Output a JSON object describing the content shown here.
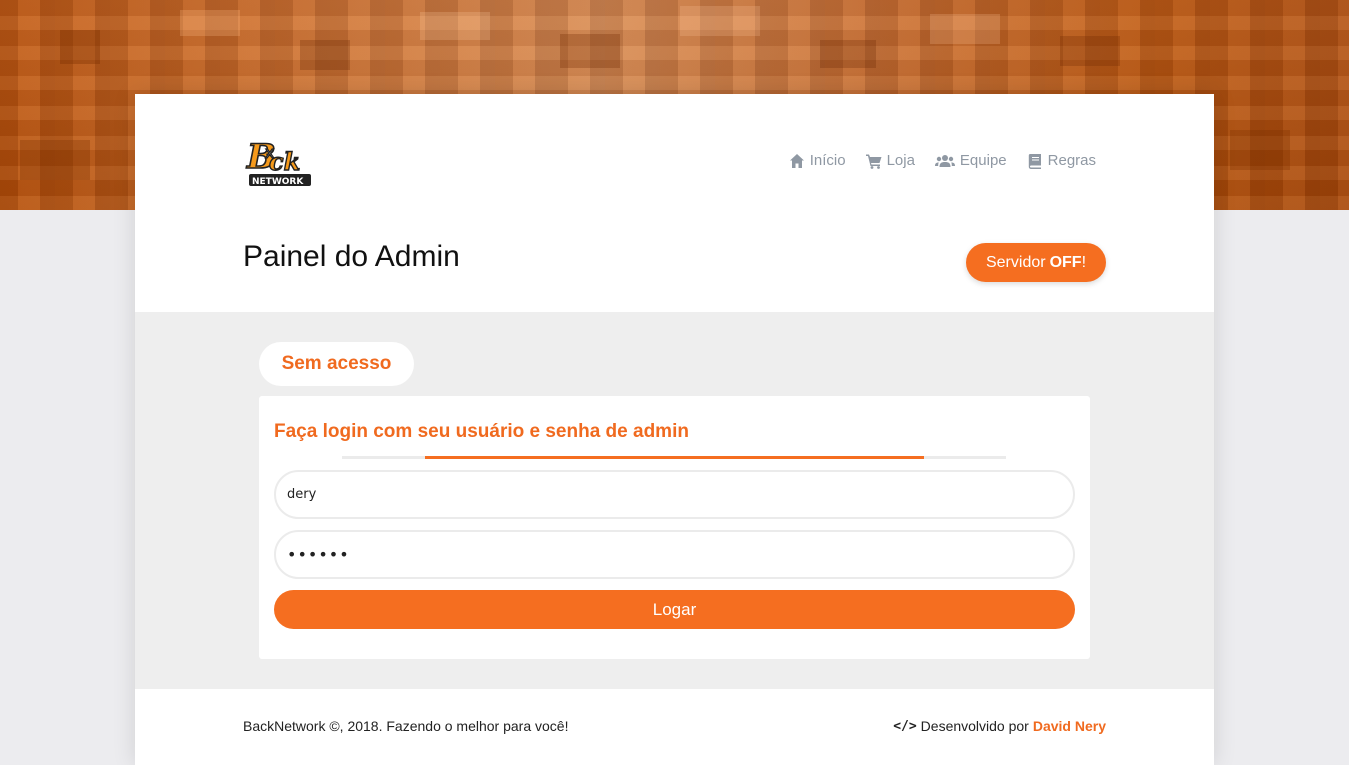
{
  "header": {
    "logo_text_top": "Back",
    "logo_text_bottom": "NETWORK",
    "nav": [
      {
        "label": "Início",
        "icon": "home-icon"
      },
      {
        "label": "Loja",
        "icon": "cart-icon"
      },
      {
        "label": "Equipe",
        "icon": "users-icon"
      },
      {
        "label": "Regras",
        "icon": "book-icon"
      }
    ]
  },
  "page_title": "Painel do Admin",
  "server_status": {
    "prefix": "Servidor",
    "state": "OFF",
    "suffix": "!"
  },
  "main": {
    "tab_label": "Sem acesso",
    "login_card": {
      "title": "Faça login com seu usuário e senha de admin",
      "username_value": "dery",
      "password_value": "••••••",
      "submit_label": "Logar"
    }
  },
  "footer": {
    "copyright": "BackNetwork ©, 2018. Fazendo o melhor para você!",
    "dev_prefix": "Desenvolvido por",
    "dev_name": "David Nery",
    "code_icon": "</>"
  },
  "colors": {
    "accent": "#f56e20",
    "accent_text": "#f06a1f",
    "nav_text": "#8f98a3"
  }
}
